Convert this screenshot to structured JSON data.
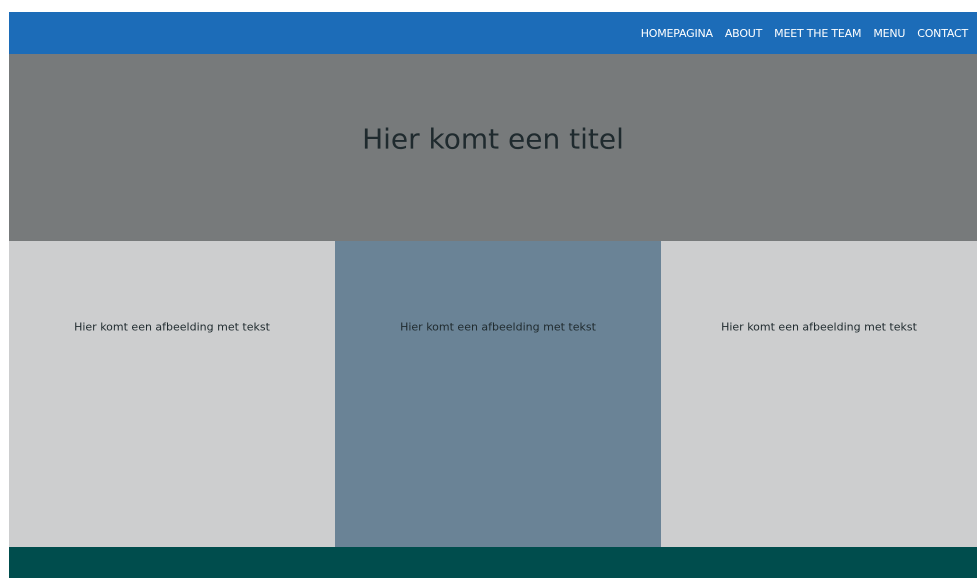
{
  "nav": {
    "items": [
      {
        "label": "HOMEPAGINA"
      },
      {
        "label": "ABOUT"
      },
      {
        "label": "MEET THE TEAM"
      },
      {
        "label": "MENU"
      },
      {
        "label": "CONTACT"
      }
    ]
  },
  "hero": {
    "title": "Hier komt een titel"
  },
  "columns": [
    {
      "text": "Hier komt een afbeelding met tekst"
    },
    {
      "text": "Hier komt een afbeelding met tekst"
    },
    {
      "text": "Hier komt een afbeelding met tekst"
    }
  ],
  "colors": {
    "nav_bar": "#1c6cb8",
    "hero_bg": "#777a7b",
    "column_light": "#cdcecf",
    "column_accent": "#6a8396",
    "footer": "#004d4d"
  }
}
